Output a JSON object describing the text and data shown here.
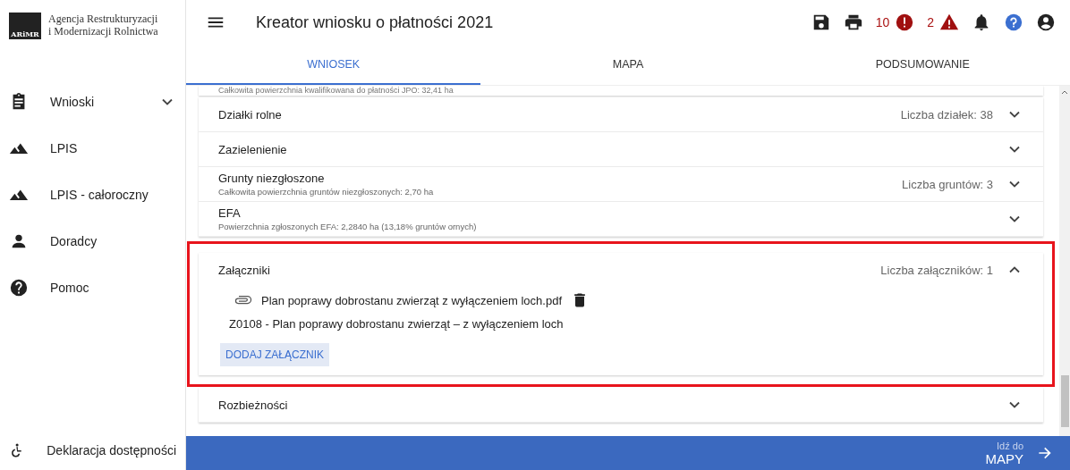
{
  "brand": {
    "logo_text": "ARiMR",
    "name_line1": "Agencja Restrukturyzacji",
    "name_line2": "i Modernizacji Rolnictwa"
  },
  "sidebar": {
    "items": [
      {
        "label": "Wnioski",
        "kind": "clipboard",
        "expandable": true
      },
      {
        "label": "LPIS",
        "kind": "mountain",
        "expandable": false
      },
      {
        "label": "LPIS - całoroczny",
        "kind": "mountain",
        "expandable": false
      },
      {
        "label": "Doradcy",
        "kind": "person",
        "expandable": false
      },
      {
        "label": "Pomoc",
        "kind": "help",
        "expandable": false
      }
    ],
    "footer": {
      "label": "Deklaracja dostępności"
    }
  },
  "header": {
    "title": "Kreator wniosku o płatności 2021",
    "error_count": "10",
    "warning_count": "2"
  },
  "tabs": [
    {
      "label": "WNIOSEK",
      "selected": true
    },
    {
      "label": "MAPA",
      "selected": false
    },
    {
      "label": "PODSUMOWANIE",
      "selected": false
    }
  ],
  "scrolled_text": "Całkowita powierzchnia kwalifikowana do płatności JPO: 32,41 ha",
  "sections": [
    {
      "title": "Działki rolne",
      "summary": "Liczba działek: 38",
      "expanded": false,
      "highlighted": false
    },
    {
      "title": "Zazielenienie",
      "expanded": false,
      "highlighted": false
    },
    {
      "title": "Grunty niezgłoszone",
      "subtitle": "Całkowita powierzchnia gruntów niezgłoszonych: 2,70 ha",
      "summary": "Liczba gruntów: 3",
      "expanded": false,
      "highlighted": false
    },
    {
      "title": "EFA",
      "subtitle": "Powierzchnia zgłoszonych EFA: 2,2840 ha (13,18% gruntów ornych)",
      "expanded": false,
      "highlighted": false
    },
    {
      "title": "Załączniki",
      "summary": "Liczba załączników: 1",
      "expanded": true,
      "highlighted": true,
      "attachments": [
        {
          "file": "Plan poprawy dobrostanu zwierząt z wyłączeniem loch.pdf",
          "type": "Z0108 - Plan poprawy dobrostanu zwierząt – z wyłączeniem loch"
        }
      ],
      "add_button": "DODAJ ZAŁĄCZNIK"
    },
    {
      "title": "Rozbieżności",
      "expanded": false,
      "highlighted": false
    }
  ],
  "next_button": {
    "caption": "Idź do",
    "label": "MAPY"
  }
}
